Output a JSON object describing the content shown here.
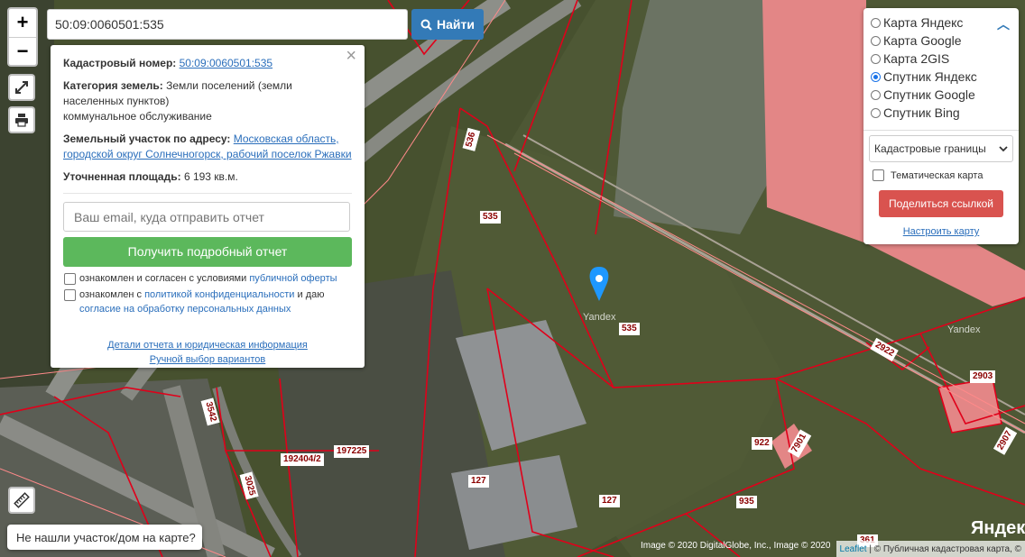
{
  "search": {
    "value": "50:09:0060501:535",
    "button_label": "Найти"
  },
  "info": {
    "cadastral_label": "Кадастровый номер:",
    "cadastral_value": "50:09:0060501:535",
    "category_label": "Категория земель:",
    "category_value": "Земли поселений (земли населенных пунктов)",
    "category_value2": "коммунальное обслуживание",
    "address_label": "Земельный участок по адресу:",
    "address_value": "Московская область, городской округ Солнечногорск, рабочий поселок Ржавки",
    "area_label": "Уточненная площадь:",
    "area_value": "6 193 кв.м.",
    "email_placeholder": "Ваш email, куда отправить отчет",
    "report_button": "Получить подробный отчет",
    "consent1_text": "ознакомлен и согласен с условиями",
    "consent1_link": "публичной оферты",
    "consent2_text": "ознакомлен с",
    "consent2_link": "политикой конфиденциальности",
    "consent2_text2": "и даю",
    "consent2_link2": "согласие на обработку персональных данных",
    "details_link": "Детали отчета и юридическая информация",
    "manual_link": "Ручной выбор вариантов"
  },
  "layers": {
    "options": [
      "Карта Яндекс",
      "Карта Google",
      "Карта 2GIS",
      "Спутник Яндекс",
      "Спутник Google",
      "Спутник Bing"
    ],
    "selected_index": 3,
    "dropdown_value": "Кадастровые границы",
    "thematic_label": "Тематическая карта",
    "share_button": "Поделиться ссылкой",
    "setup_link": "Настроить карту"
  },
  "not_found": "Не нашли участок/дом на карте?",
  "parcel_labels": [
    "536",
    "535",
    "535",
    "3542",
    "3025",
    "192404/2",
    "197225",
    "127",
    "127",
    "935",
    "922",
    "7901",
    "2922",
    "2903",
    "2907",
    "361"
  ],
  "watermarks": [
    "Yandex",
    "Yandex"
  ],
  "image_credit": "Image © 2020 DigitalGlobe, Inc., Image © 2020",
  "attribution": {
    "leaflet": "Leaflet",
    "rest": "| © Публичная кадастровая карта, ©"
  },
  "yandex_mark": "Яндекс",
  "colors": {
    "primary": "#337ab7",
    "success": "#5cb85c",
    "danger": "#d9534f",
    "parcel_border": "#e0001a"
  }
}
